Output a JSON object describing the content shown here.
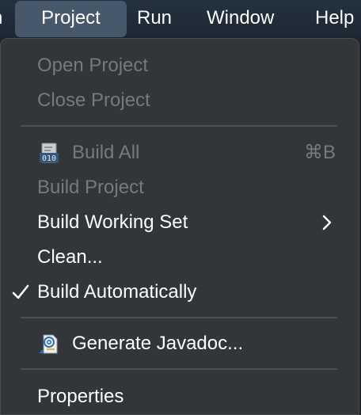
{
  "menubar": {
    "items": [
      {
        "label": "n"
      },
      {
        "label": "Project"
      },
      {
        "label": "Run"
      },
      {
        "label": "Window"
      },
      {
        "label": "Help"
      }
    ]
  },
  "menu": {
    "items": [
      {
        "label": "Open Project"
      },
      {
        "label": "Close Project"
      },
      {
        "label": "Build All",
        "shortcut": "⌘B",
        "icon": "binary-file-icon"
      },
      {
        "label": "Build Project"
      },
      {
        "label": "Build Working Set"
      },
      {
        "label": "Clean..."
      },
      {
        "label": "Build Automatically",
        "checked": true
      },
      {
        "label": "Generate Javadoc...",
        "icon": "javadoc-icon"
      },
      {
        "label": "Properties"
      }
    ]
  },
  "colors": {
    "menubar_bg": "#1e2a36",
    "active_menu_bg": "#46586a",
    "menu_bg": "#323638",
    "disabled_text": "#77797b",
    "enabled_text": "#ffffff"
  }
}
